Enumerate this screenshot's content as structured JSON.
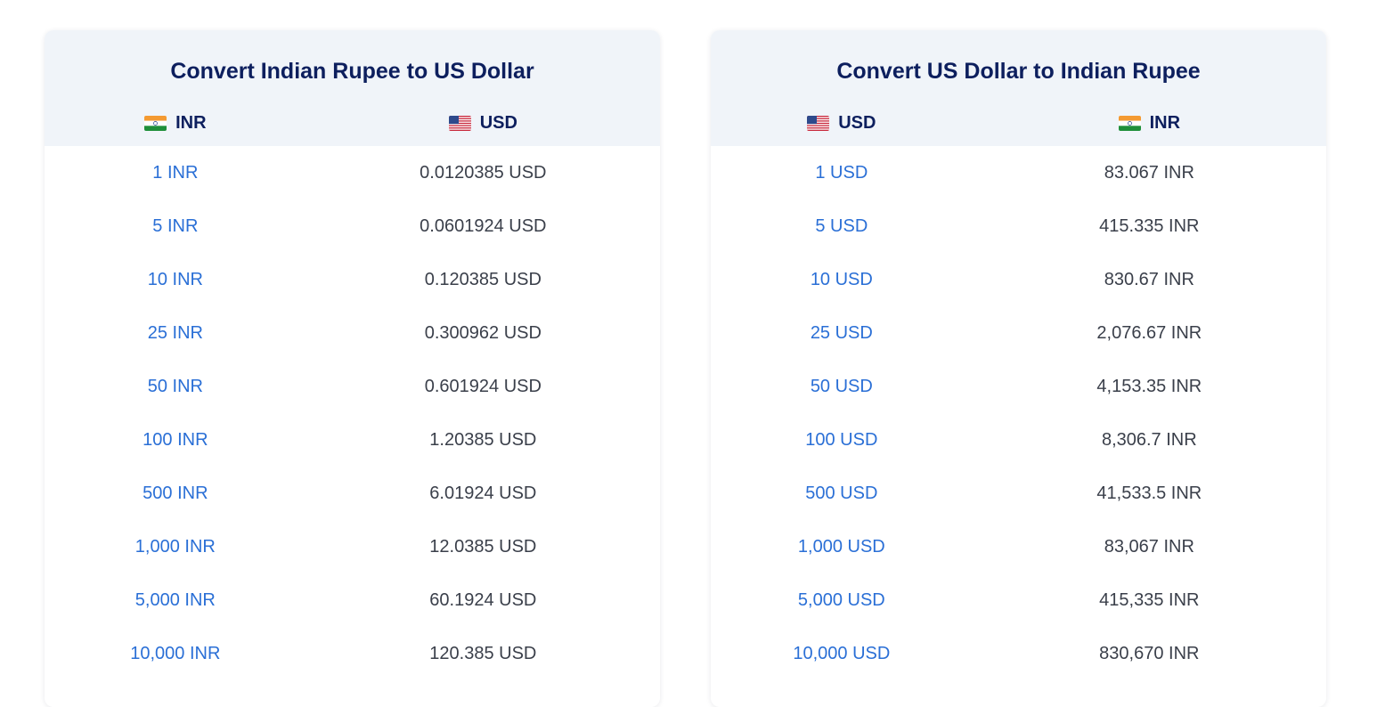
{
  "inr_to_usd": {
    "title": "Convert Indian Rupee to US Dollar",
    "from_currency": "INR",
    "to_currency": "USD",
    "from_flag_icon": "india-flag-icon",
    "to_flag_icon": "us-flag-icon",
    "rows": [
      {
        "from": "1 INR",
        "to": "0.0120385 USD"
      },
      {
        "from": "5 INR",
        "to": "0.0601924 USD"
      },
      {
        "from": "10 INR",
        "to": "0.120385 USD"
      },
      {
        "from": "25 INR",
        "to": "0.300962 USD"
      },
      {
        "from": "50 INR",
        "to": "0.601924 USD"
      },
      {
        "from": "100 INR",
        "to": "1.20385 USD"
      },
      {
        "from": "500 INR",
        "to": "6.01924 USD"
      },
      {
        "from": "1,000 INR",
        "to": "12.0385 USD"
      },
      {
        "from": "5,000 INR",
        "to": "60.1924 USD"
      },
      {
        "from": "10,000 INR",
        "to": "120.385 USD"
      }
    ]
  },
  "usd_to_inr": {
    "title": "Convert US Dollar to Indian Rupee",
    "from_currency": "USD",
    "to_currency": "INR",
    "from_flag_icon": "us-flag-icon",
    "to_flag_icon": "india-flag-icon",
    "rows": [
      {
        "from": "1 USD",
        "to": "83.067 INR"
      },
      {
        "from": "5 USD",
        "to": "415.335 INR"
      },
      {
        "from": "10 USD",
        "to": "830.67 INR"
      },
      {
        "from": "25 USD",
        "to": "2,076.67 INR"
      },
      {
        "from": "50 USD",
        "to": "4,153.35 INR"
      },
      {
        "from": "100 USD",
        "to": "8,306.7 INR"
      },
      {
        "from": "500 USD",
        "to": "41,533.5 INR"
      },
      {
        "from": "1,000 USD",
        "to": "83,067 INR"
      },
      {
        "from": "5,000 USD",
        "to": "415,335 INR"
      },
      {
        "from": "10,000 USD",
        "to": "830,670 INR"
      }
    ]
  },
  "colors": {
    "title": "#0d1f5e",
    "link": "#2a6fd6",
    "value": "#3a3f4a",
    "header_bg": "#f0f4f9"
  }
}
